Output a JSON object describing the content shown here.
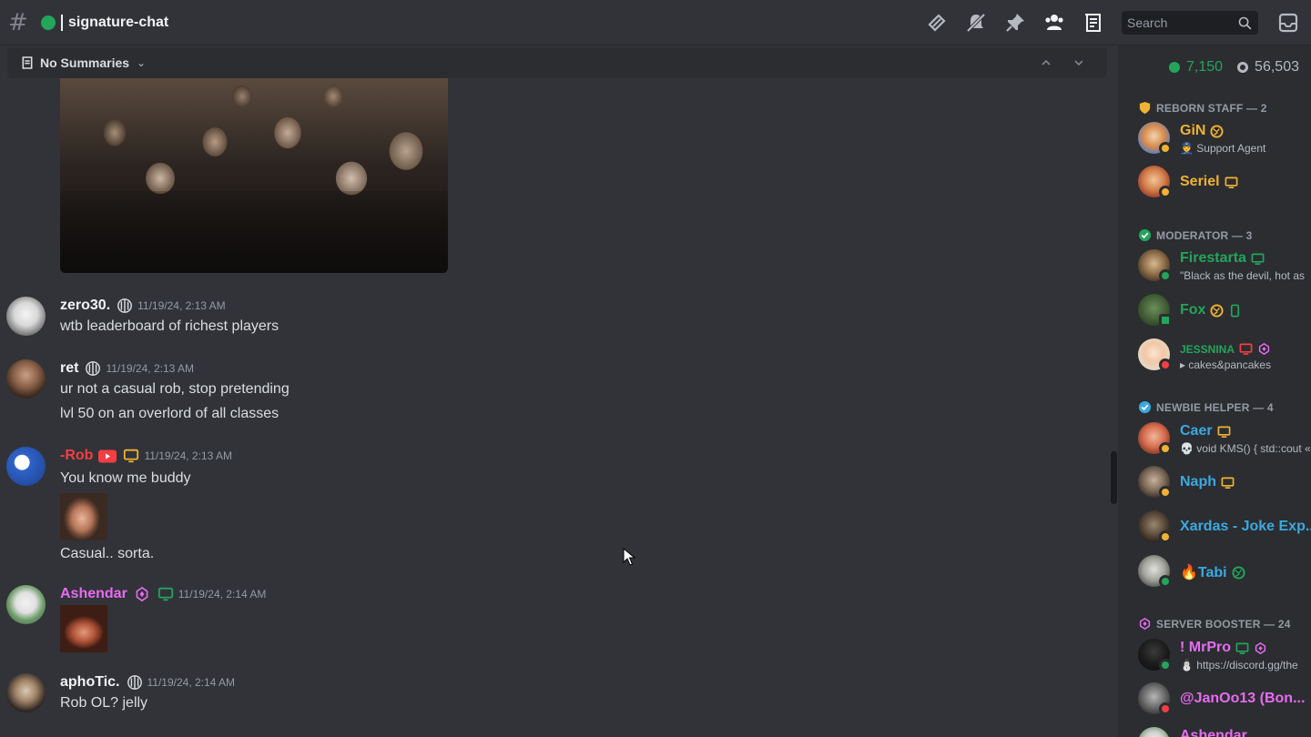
{
  "header": {
    "channel_name": "signature-chat",
    "search_placeholder": "Search",
    "icons": [
      "threads-icon",
      "mute-icon",
      "pin-icon",
      "members-icon",
      "summaries-icon",
      "search-icon",
      "inbox-icon"
    ]
  },
  "summaries": {
    "label": "No Summaries"
  },
  "messages": [
    {
      "username": "zero30.",
      "name_color": "#f2f3f5",
      "timestamp": "11/19/24, 2:13 AM",
      "lines": [
        "wtb leaderboard of richest players"
      ]
    },
    {
      "username": "ret",
      "name_color": "#f2f3f5",
      "timestamp": "11/19/24, 2:13 AM",
      "lines": [
        "ur not a casual rob, stop pretending",
        "lvl 50 on an overlord of all classes"
      ]
    },
    {
      "username": "-Rob",
      "name_color": "#f23f43",
      "timestamp": "11/19/24, 2:13 AM",
      "lines": [
        "You know me buddy",
        "Casual.. sorta."
      ]
    },
    {
      "username": "Ashendar",
      "name_color": "#e86bf2",
      "timestamp": "11/19/24, 2:14 AM",
      "lines": []
    },
    {
      "username": "aphoTic.",
      "name_color": "#f2f3f5",
      "timestamp": "11/19/24, 2:14 AM",
      "lines": [
        "Rob OL? jelly"
      ]
    }
  ],
  "member_list": {
    "online_count": "7,150",
    "total_count": "56,503",
    "roles": [
      {
        "title": "REBORN STAFF — 2",
        "icon": "shield-icon"
      },
      {
        "title": "MODERATOR — 3",
        "icon": "check-icon"
      },
      {
        "title": "NEWBIE HELPER — 4",
        "icon": "verified-icon"
      },
      {
        "title": "SERVER BOOSTER — 24",
        "icon": "boost-icon"
      }
    ],
    "members": [
      {
        "name": "GiN",
        "color": "#f0b232",
        "sub": "👮 Support Agent",
        "status": "#f0b232"
      },
      {
        "name": "Seriel",
        "color": "#f0b232",
        "sub": "",
        "status": "#f0b232"
      },
      {
        "name": "Firestarta",
        "color": "#23a55a",
        "sub": "\"Black as the devil, hot as",
        "status": "#23a55a"
      },
      {
        "name": "Fox",
        "color": "#23a55a",
        "sub": "",
        "status": "#23a55a"
      },
      {
        "name": "JESSNINA",
        "color": "#23a55a",
        "sub": "▸ cakes&pancakes",
        "status": "#f23f43"
      },
      {
        "name": "Caer",
        "color": "#3ba9e0",
        "sub": "💀 void KMS() { std::cout «",
        "status": "#f0b232"
      },
      {
        "name": "Naph",
        "color": "#3ba9e0",
        "sub": "",
        "status": "#f0b232"
      },
      {
        "name": "Xardas - Joke Exp...",
        "color": "#3ba9e0",
        "sub": "",
        "status": "#f0b232"
      },
      {
        "name": "🔥Tabi",
        "color": "#3ba9e0",
        "sub": "",
        "status": "#23a55a"
      },
      {
        "name": "! MrPro",
        "color": "#e86bf2",
        "sub": "⛄ https://discord.gg/the",
        "status": "#23a55a"
      },
      {
        "name": "@JanOo13 (Bon...",
        "color": "#e86bf2",
        "sub": "",
        "status": "#f23f43"
      },
      {
        "name": "Ashendar",
        "color": "#e86bf2",
        "sub": "",
        "status": "#23a55a"
      }
    ]
  },
  "colors": {
    "accent_green": "#23a55a",
    "staff_gold": "#f0b232",
    "booster_pink": "#e86bf2",
    "helper_blue": "#3ba9e0"
  }
}
